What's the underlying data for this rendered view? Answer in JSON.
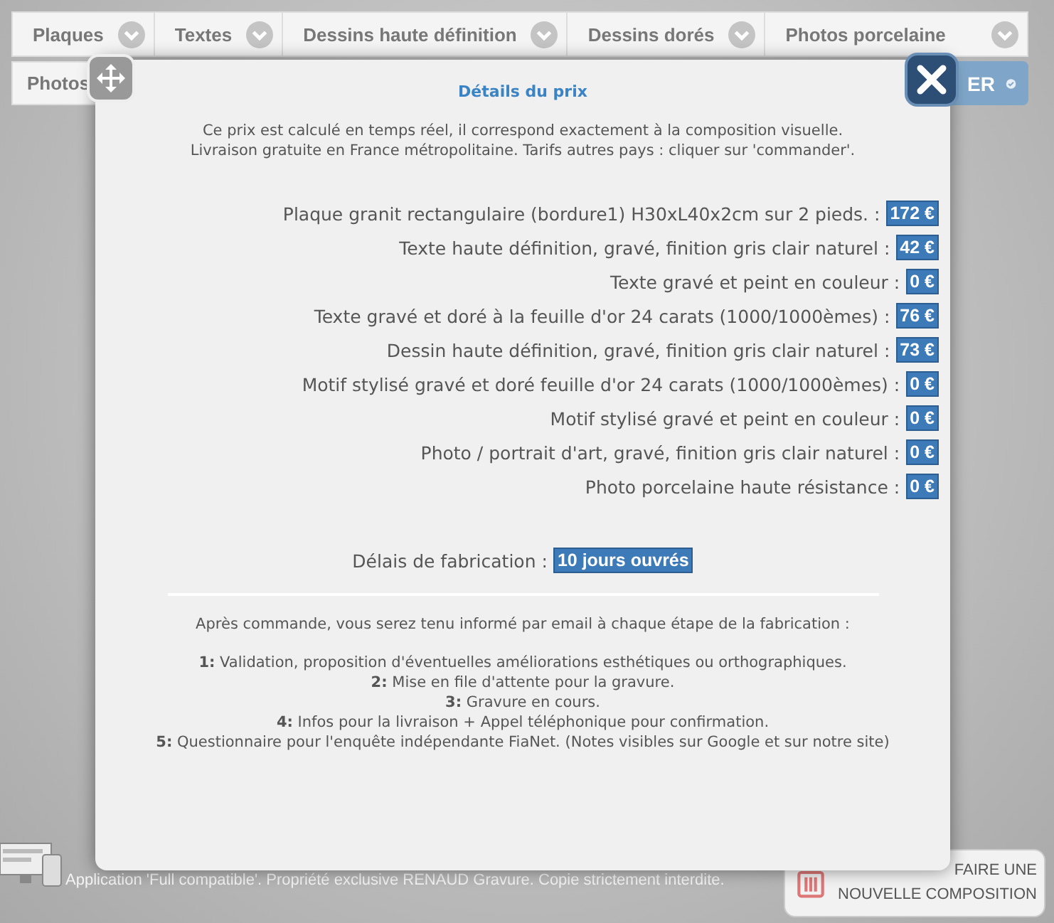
{
  "tabs": [
    {
      "label": "Plaques"
    },
    {
      "label": "Textes"
    },
    {
      "label": "Dessins haute définition"
    },
    {
      "label": "Dessins dorés"
    },
    {
      "label": "Photos porcelaine"
    }
  ],
  "second_row": {
    "tab": "Photos",
    "order_button": "ER"
  },
  "modal": {
    "title": "Détails du prix",
    "intro": [
      "Ce prix est calculé en temps réel, il correspond exactement à la composition visuelle.",
      "Livraison gratuite en France métropolitaine. Tarifs autres pays : cliquer sur 'commander'."
    ],
    "prices": [
      {
        "label": "Plaque granit rectangulaire (bordure1) H30xL40x2cm sur 2 pieds. :",
        "amount": "172 €"
      },
      {
        "label": "Texte haute définition, gravé, finition gris clair naturel :",
        "amount": "42 €"
      },
      {
        "label": "Texte gravé et peint en couleur :",
        "amount": "0 €"
      },
      {
        "label": "Texte gravé et doré à la feuille d'or 24 carats (1000/1000èmes) :",
        "amount": "76 €"
      },
      {
        "label": "Dessin haute définition, gravé, finition gris clair naturel :",
        "amount": "73 €"
      },
      {
        "label": "Motif stylisé gravé et doré feuille d'or 24 carats (1000/1000èmes) :",
        "amount": "0 €"
      },
      {
        "label": "Motif stylisé gravé et peint en couleur :",
        "amount": "0 €"
      },
      {
        "label": "Photo / portrait d'art, gravé, finition gris clair naturel :",
        "amount": "0 €"
      },
      {
        "label": "Photo porcelaine haute résistance :",
        "amount": "0 €"
      }
    ],
    "delay": {
      "label": "Délais de fabrication :",
      "value": "10 jours ouvrés"
    },
    "steps_intro": "Après commande, vous serez tenu informé par email à chaque étape de la fabrication :",
    "steps": [
      "**1:** Validation, proposition d'éventuelles améliorations esthétiques ou orthographiques.",
      "**2:** Mise en file d'attente pour la gravure.",
      "**3:** Gravure en cours.",
      "**4:** Infos pour la livraison + Appel téléphonique pour confirmation.",
      "**5:** Questionnaire pour l'enquête indépendante FiaNet. (Notes visibles sur Google et sur notre site)"
    ]
  },
  "footer": {
    "text": "Application 'Full compatible'. Propriété exclusive RENAUD Gravure. Copie strictement interdite.",
    "reset_button": [
      "FAIRE UNE",
      "NOUVELLE COMPOSITION"
    ]
  }
}
